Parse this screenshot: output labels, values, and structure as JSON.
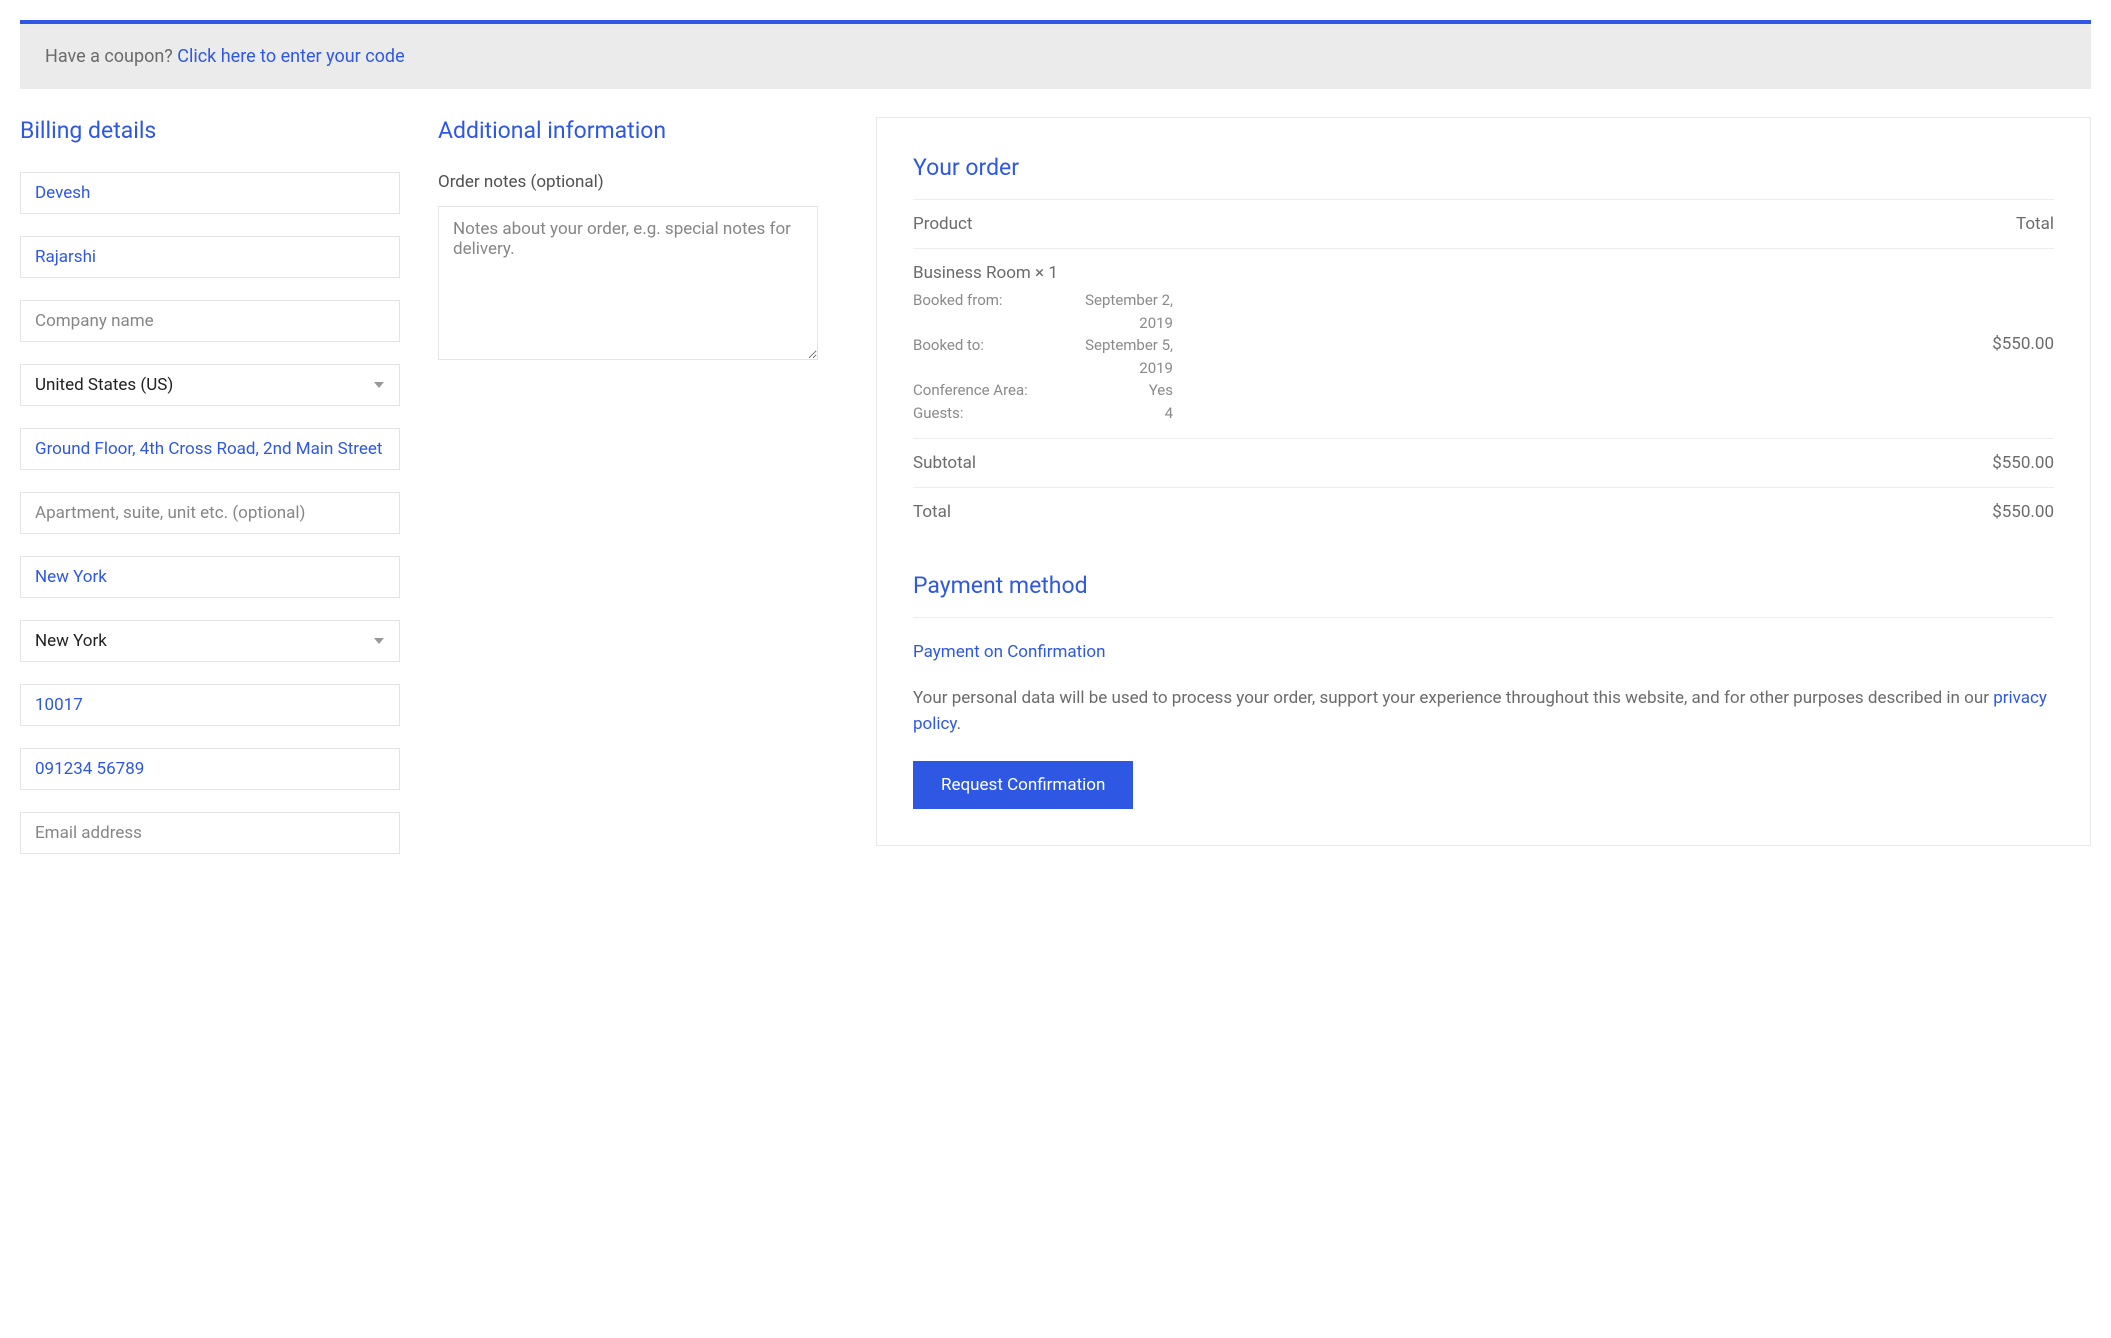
{
  "coupon": {
    "text": "Have a coupon? ",
    "link": "Click here to enter your code"
  },
  "billing": {
    "title": "Billing details",
    "first_name": "Devesh",
    "last_name": "Rajarshi",
    "company_placeholder": "Company name",
    "country": "United States (US)",
    "address1": "Ground Floor, 4th Cross Road, 2nd Main Street",
    "address2_placeholder": "Apartment, suite, unit etc. (optional)",
    "city": "New York",
    "state": "New York",
    "postcode": "10017",
    "phone": "091234 56789",
    "email_placeholder": "Email address"
  },
  "additional": {
    "title": "Additional information",
    "notes_label": "Order notes (optional)",
    "notes_placeholder": "Notes about your order, e.g. special notes for delivery."
  },
  "order": {
    "title": "Your order",
    "header_product": "Product",
    "header_total": "Total",
    "product_name": "Business Room ",
    "product_qty": " × 1",
    "line_total": "$550.00",
    "meta": {
      "booked_from_label": "Booked from:",
      "booked_from_value": "September 2, 2019",
      "booked_to_label": "Booked to:",
      "booked_to_value": "September 5, 2019",
      "conference_label": "Conference Area:",
      "conference_value": "Yes",
      "guests_label": "Guests:",
      "guests_value": "4"
    },
    "subtotal_label": "Subtotal",
    "subtotal_value": "$550.00",
    "total_label": "Total",
    "total_value": "$550.00"
  },
  "payment": {
    "title": "Payment method",
    "method_name": "Payment on Confirmation",
    "privacy_text": "Your personal data will be used to process your order, support your experience throughout this website, and for other purposes described in our ",
    "privacy_link": "privacy policy",
    "privacy_after": ".",
    "button": "Request Confirmation"
  }
}
